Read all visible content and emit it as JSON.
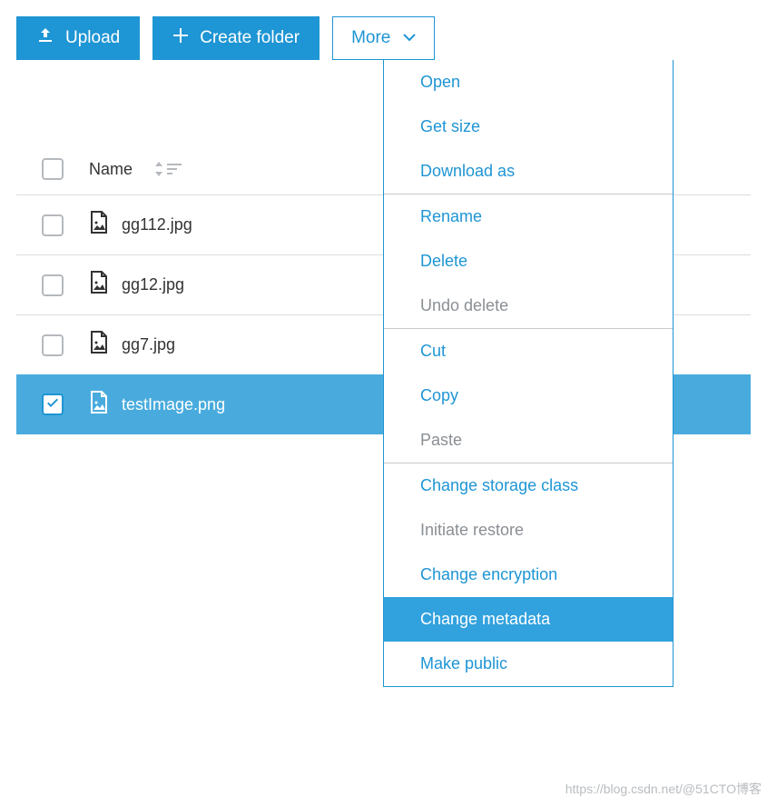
{
  "toolbar": {
    "upload_label": "Upload",
    "create_folder_label": "Create folder",
    "more_label": "More"
  },
  "columns": {
    "name_label": "Name"
  },
  "files": [
    {
      "name": "gg112.jpg",
      "selected": false
    },
    {
      "name": "gg12.jpg",
      "selected": false
    },
    {
      "name": "gg7.jpg",
      "selected": false
    },
    {
      "name": "testImage.png",
      "selected": true
    }
  ],
  "more_menu": [
    {
      "items": [
        {
          "label": "Open",
          "enabled": true
        },
        {
          "label": "Get size",
          "enabled": true
        },
        {
          "label": "Download as",
          "enabled": true
        }
      ]
    },
    {
      "items": [
        {
          "label": "Rename",
          "enabled": true
        },
        {
          "label": "Delete",
          "enabled": true
        },
        {
          "label": "Undo delete",
          "enabled": false
        }
      ]
    },
    {
      "items": [
        {
          "label": "Cut",
          "enabled": true
        },
        {
          "label": "Copy",
          "enabled": true
        },
        {
          "label": "Paste",
          "enabled": false
        }
      ]
    },
    {
      "items": [
        {
          "label": "Change storage class",
          "enabled": true
        },
        {
          "label": "Initiate restore",
          "enabled": false
        },
        {
          "label": "Change encryption",
          "enabled": true
        },
        {
          "label": "Change metadata",
          "enabled": true,
          "hover": true
        },
        {
          "label": "Make public",
          "enabled": true
        }
      ]
    }
  ],
  "watermark": "https://blog.csdn.net/@51CTO博客"
}
